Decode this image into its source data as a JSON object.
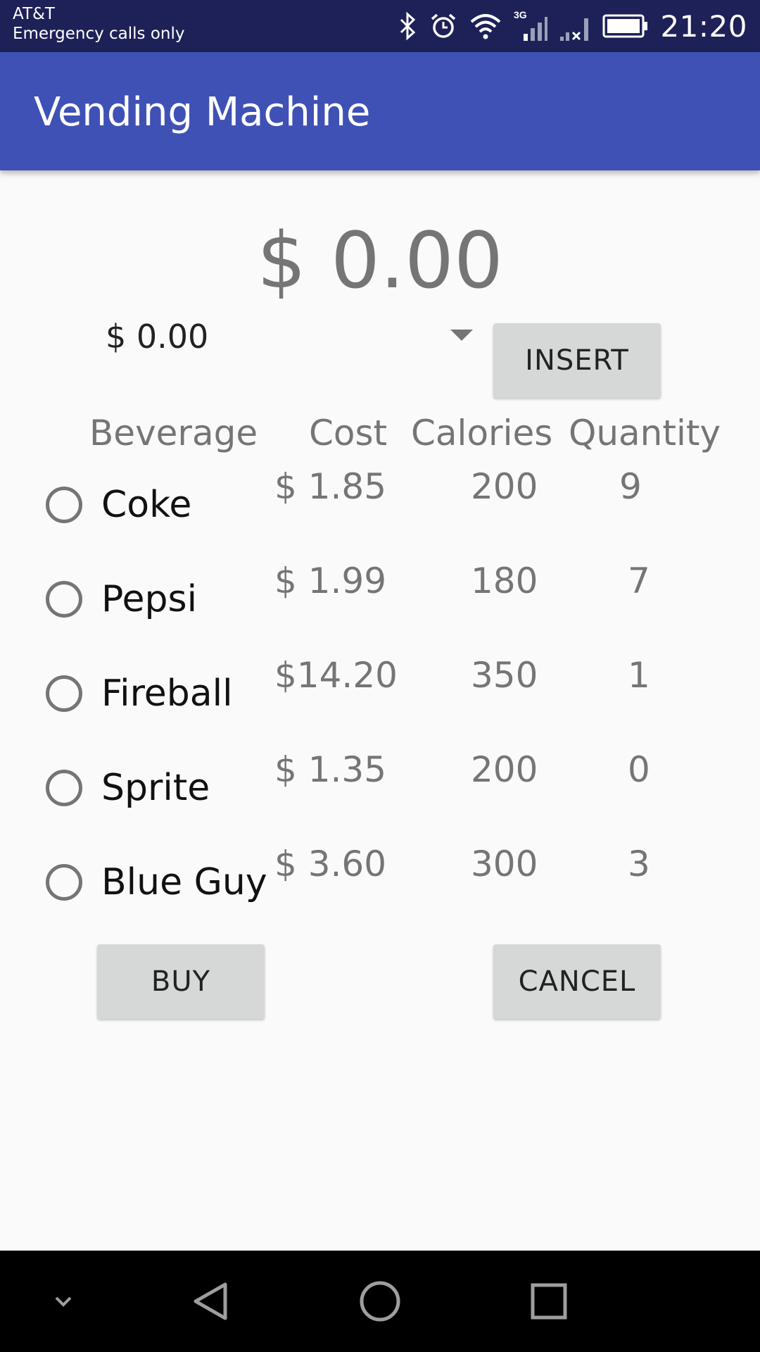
{
  "status_bar": {
    "carrier": "AT&T",
    "carrier_note": "Emergency calls only",
    "network": "3G",
    "time": "21:20",
    "icons": [
      "bluetooth-icon",
      "alarm-icon",
      "wifi-icon",
      "signal-3g-icon",
      "signal-no-service-icon",
      "battery-icon"
    ]
  },
  "app_bar": {
    "title": "Vending Machine",
    "color": "#3f51b5"
  },
  "balance": {
    "value": "$ 0.00"
  },
  "amount_spinner": {
    "selected": "$ 0.00"
  },
  "buttons": {
    "insert": "INSERT",
    "buy": "BUY",
    "cancel": "CANCEL"
  },
  "table": {
    "headers": {
      "beverage": "Beverage",
      "cost": "Cost",
      "calories": "Calories",
      "quantity": "Quantity"
    },
    "rows": [
      {
        "name": "Coke",
        "cost": "$ 1.85",
        "calories": "200",
        "quantity": "9",
        "selected": false
      },
      {
        "name": "Pepsi",
        "cost": "$ 1.99",
        "calories": "180",
        "quantity": "7",
        "selected": false
      },
      {
        "name": "Fireball",
        "cost": "$14.20",
        "calories": "350",
        "quantity": "1",
        "selected": false
      },
      {
        "name": "Sprite",
        "cost": "$ 1.35",
        "calories": "200",
        "quantity": "0",
        "selected": false
      },
      {
        "name": "Blue Guy",
        "cost": "$ 3.60",
        "calories": "300",
        "quantity": "3",
        "selected": false
      }
    ]
  },
  "nav_bar": {
    "icons": [
      "collapse-chevron-icon",
      "back-icon",
      "home-icon",
      "recents-icon"
    ]
  }
}
